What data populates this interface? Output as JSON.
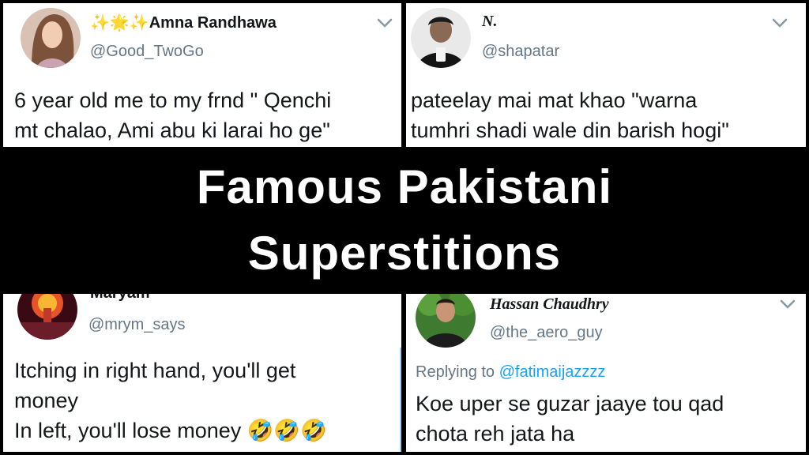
{
  "tweets": [
    {
      "name": "Amna Randhawa",
      "name_prefix": "✨🌟✨",
      "handle": "@Good_TwoGo",
      "text": "6 year old me to my frnd \" Qenchi\nmt chalao, Ami abu ki larai ho ge\""
    },
    {
      "name": "N.",
      "handle": "@shapatar",
      "text": "pateelay mai mat khao \"warna\ntumhri shadi wale din barish hogi\""
    },
    {
      "name": "Maryam",
      "handle": "@mrym_says",
      "text": "Itching in right hand, you'll get\nmoney\nIn left, you'll lose money 🤣🤣🤣"
    },
    {
      "name": "Hassan Chaudhry",
      "handle": "@the_aero_guy",
      "reply_prefix": "Replying to",
      "reply_to": "@fatimaijazzzz",
      "text": "Koe uper se guzar jaaye tou qad\nchota reh jata ha"
    }
  ],
  "banner": {
    "line1": "Famous Pakistani",
    "line2": "Superstitions"
  },
  "colors": {
    "text": "#14171a",
    "handle": "#657786",
    "mention": "#1da1f2",
    "banner_bg": "#000000",
    "banner_text": "#ffffff"
  },
  "icons": [
    "chevron-down-icon",
    "avatar"
  ]
}
